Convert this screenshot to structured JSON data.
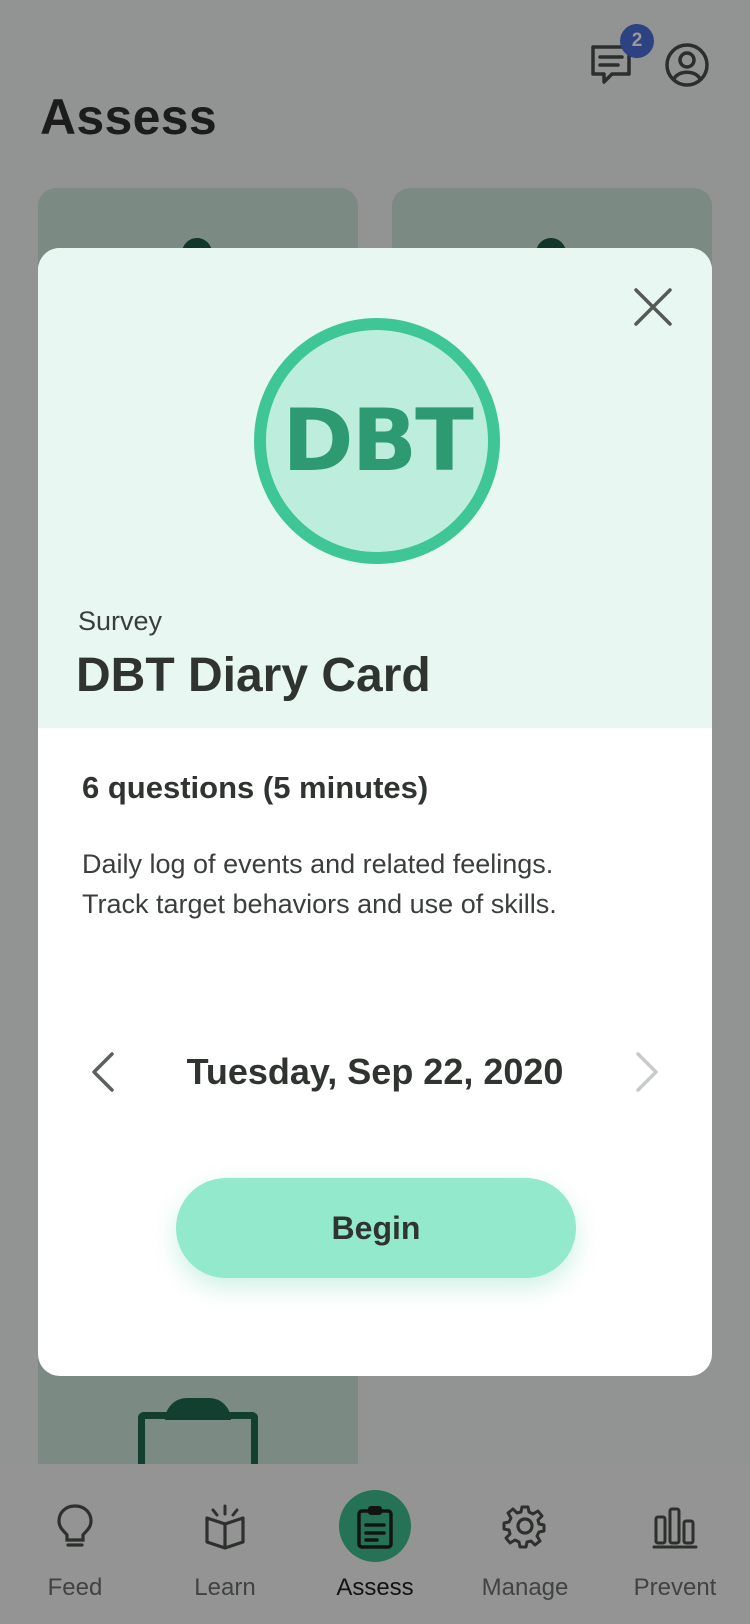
{
  "header": {
    "title": "Assess",
    "messages_badge": "2"
  },
  "modal": {
    "logo_text": "DBT",
    "kind": "Survey",
    "title": "DBT Diary Card",
    "question_count": "6 questions (5 minutes)",
    "description_line1": "Daily log of events and related feelings.",
    "description_line2": "Track target behaviors and use of skills.",
    "date": "Tuesday, Sep 22, 2020",
    "begin_label": "Begin"
  },
  "nav": {
    "items": [
      {
        "label": "Feed",
        "icon": "lightbulb-icon"
      },
      {
        "label": "Learn",
        "icon": "book-icon"
      },
      {
        "label": "Assess",
        "icon": "clipboard-icon",
        "active": true
      },
      {
        "label": "Manage",
        "icon": "gear-icon"
      },
      {
        "label": "Prevent",
        "icon": "bar-chart-icon"
      }
    ]
  },
  "colors": {
    "accent": "#3fc697",
    "button": "#93e9cb",
    "badge": "#4a6fd8",
    "modal_header_bg": "#e8f7f1"
  }
}
